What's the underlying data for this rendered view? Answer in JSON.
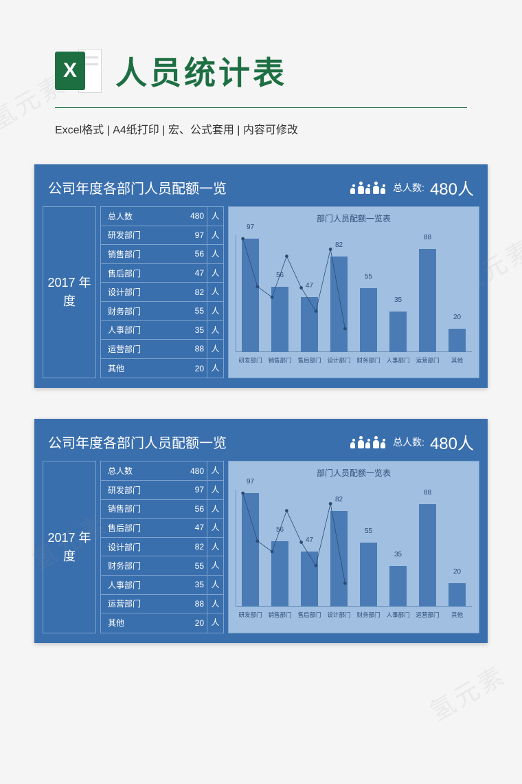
{
  "watermark": "氢元素",
  "header": {
    "icon_letter": "X",
    "title": "人员统计表"
  },
  "subtitle_parts": {
    "p1": "Excel格式",
    "p2": "A4纸打印",
    "p3": "宏、公式套用",
    "p4": "内容可修改",
    "sep": " | "
  },
  "card": {
    "title": "公司年度各部门人员配额一览",
    "total_label": "总人数:",
    "total_value": "480人",
    "year": "2017\n年度",
    "unit": "人",
    "rows": [
      {
        "name": "总人数",
        "value": 480
      },
      {
        "name": "研发部门",
        "value": 97
      },
      {
        "name": "销售部门",
        "value": 56
      },
      {
        "name": "售后部门",
        "value": 47
      },
      {
        "name": "设计部门",
        "value": 82
      },
      {
        "name": "财务部门",
        "value": 55
      },
      {
        "name": "人事部门",
        "value": 35
      },
      {
        "name": "运营部门",
        "value": 88
      },
      {
        "name": "其他",
        "value": 20
      }
    ]
  },
  "chart_data": {
    "type": "bar",
    "title": "部门人员配额一览表",
    "categories": [
      "研发部门",
      "销售部门",
      "售后部门",
      "设计部门",
      "财务部门",
      "人事部门",
      "运营部门",
      "其他"
    ],
    "values": [
      97,
      56,
      47,
      82,
      55,
      35,
      88,
      20
    ],
    "data_labels": [
      "97",
      "56",
      "47",
      "82",
      "55",
      "35",
      "88",
      "20"
    ],
    "ylim": [
      0,
      100
    ],
    "overlay_line": true
  }
}
